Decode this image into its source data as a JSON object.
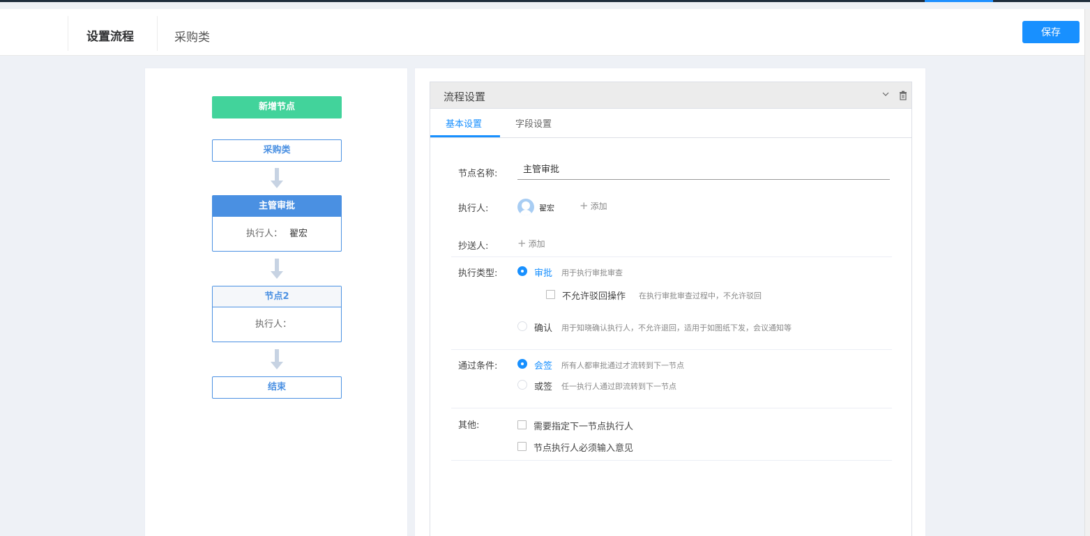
{
  "header": {
    "title": "设置流程",
    "subtitle": "采购类",
    "save_label": "保存"
  },
  "flow": {
    "add_node_label": "新增节点",
    "start_label": "采购类",
    "nodes": [
      {
        "name": "主管审批",
        "executor_label": "执行人：",
        "executor": "翟宏",
        "active": true
      },
      {
        "name": "节点2",
        "executor_label": "执行人：",
        "executor": "",
        "active": false
      }
    ],
    "end_label": "结束"
  },
  "settings": {
    "title": "流程设置",
    "tabs": [
      {
        "label": "基本设置",
        "active": true
      },
      {
        "label": "字段设置",
        "active": false
      }
    ],
    "node_name_label": "节点名称:",
    "node_name_value": "主管审批",
    "executor_label": "执行人:",
    "executor_name": "翟宏",
    "add_label": "添加",
    "cc_label": "抄送人:",
    "exec_type_label": "执行类型:",
    "exec_types": [
      {
        "label": "审批",
        "desc": "用于执行审批审查",
        "checked": true
      },
      {
        "label": "确认",
        "desc": "用于知晓确认执行人，不允许退回，适用于如图纸下发，会议通知等",
        "checked": false
      }
    ],
    "no_reject_label": "不允许驳回操作",
    "no_reject_desc": "在执行审批审查过程中，不允许驳回",
    "pass_label": "通过条件:",
    "pass_options": [
      {
        "label": "会签",
        "desc": "所有人都审批通过才流转到下一节点",
        "checked": true
      },
      {
        "label": "或签",
        "desc": "任一执行人通过即流转到下一节点",
        "checked": false
      }
    ],
    "other_label": "其他:",
    "other_options": [
      "需要指定下一节点执行人",
      "节点执行人必须输入意见"
    ]
  },
  "colors": {
    "primary": "#1890ff",
    "add_node": "#42d39b",
    "node_blue": "#4a90e2",
    "arrow": "#c7d3e3"
  }
}
